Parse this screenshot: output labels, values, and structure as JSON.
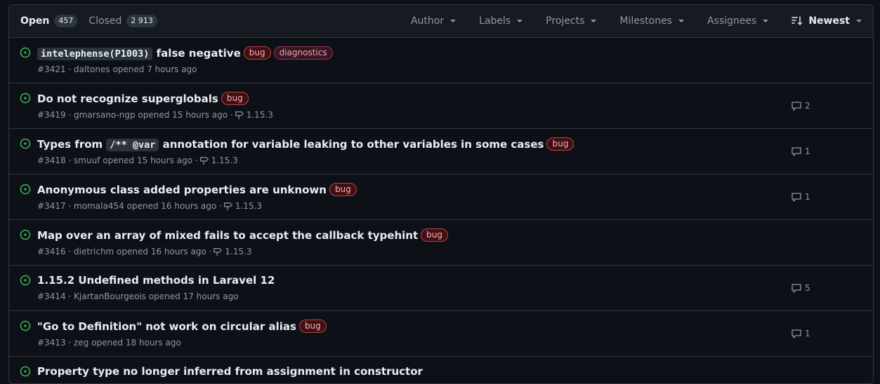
{
  "header": {
    "open_label": "Open",
    "open_count": "457",
    "closed_label": "Closed",
    "closed_count": "2 913",
    "filters": {
      "author": "Author",
      "labels": "Labels",
      "projects": "Projects",
      "milestones": "Milestones",
      "assignees": "Assignees",
      "sort": "Newest"
    }
  },
  "issues": [
    {
      "code": "intelephense(P1003)",
      "title": " false negative",
      "labels": [
        "bug",
        "diagnostics"
      ],
      "meta": "#3421 · daltones opened 7 hours ago"
    },
    {
      "title": "Do not recognize superglobals",
      "labels": [
        "bug"
      ],
      "meta": "#3419 · gmarsano-ngp opened 15 hours ago ·",
      "milestone": "1.15.3",
      "comments": "2"
    },
    {
      "title_pre": "Types from ",
      "code": "/** @var",
      "title_post": " annotation for variable leaking to other variables in some cases",
      "labels": [
        "bug"
      ],
      "meta": "#3418 · smuuf opened 15 hours ago ·",
      "milestone": "1.15.3",
      "comments": "1"
    },
    {
      "title": "Anonymous class added properties are unknown",
      "labels": [
        "bug"
      ],
      "meta": "#3417 · momala454 opened 16 hours ago ·",
      "milestone": "1.15.3",
      "comments": "1"
    },
    {
      "title": "Map over an array of mixed fails to accept the callback typehint",
      "labels": [
        "bug"
      ],
      "meta": "#3416 · dietrichm opened 16 hours ago ·",
      "milestone": "1.15.3"
    },
    {
      "title": "1.15.2 Undefined methods in Laravel 12",
      "meta": "#3414 · KjartanBourgeois opened 17 hours ago",
      "comments": "5"
    },
    {
      "title": "\"Go to Definition\" not work on circular alias",
      "labels": [
        "bug"
      ],
      "meta": "#3413 · zeg opened 18 hours ago",
      "comments": "1"
    },
    {
      "title": "Property type no longer inferred from assignment in constructor"
    }
  ],
  "colors": {
    "open_icon": "#3fb950",
    "bug_label": "#b5474d",
    "diagnostics_label": "#8a3a52"
  }
}
